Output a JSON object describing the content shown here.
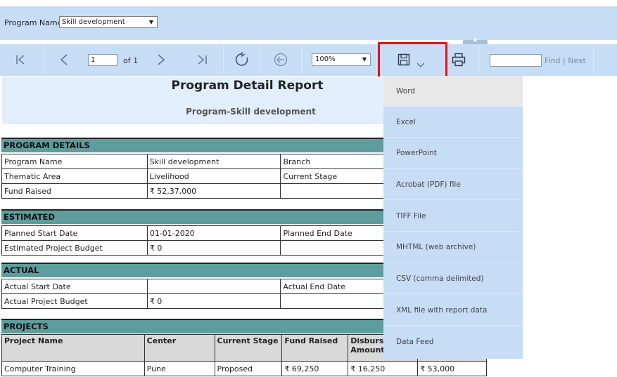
{
  "params": {
    "program_label": "Program Name",
    "program_value": "Skill development"
  },
  "toolbar": {
    "page_value": "1",
    "of_label": "of 1",
    "zoom_value": "100%",
    "find_links": "Find | Next"
  },
  "report": {
    "title": "Program Detail Report",
    "subtitle": "Program-Skill development",
    "program_details": {
      "heading": "PROGRAM DETAILS",
      "rows": [
        [
          "Program Name",
          "Skill development",
          "Branch",
          ""
        ],
        [
          "Thematic Area",
          "Livelihood",
          "Current Stage",
          ""
        ],
        [
          "Fund Raised",
          "₹ 52,37,000",
          "",
          ""
        ]
      ]
    },
    "estimated": {
      "heading": "ESTIMATED",
      "rows": [
        [
          "Planned Start Date",
          "01-01-2020",
          "Planned End Date",
          ""
        ],
        [
          "Estimated Project Budget",
          "₹ 0",
          "",
          ""
        ]
      ]
    },
    "actual": {
      "heading": "ACTUAL",
      "rows": [
        [
          "Actual Start Date",
          "",
          "Actual End Date",
          ""
        ],
        [
          "Actual Project Budget",
          "₹ 0",
          "",
          ""
        ]
      ]
    },
    "projects": {
      "heading": "PROJECTS",
      "columns": [
        "Project Name",
        "Center",
        "Current Stage",
        "Fund Raised",
        "Disburse",
        "Amount"
      ],
      "row": [
        "Computer Training",
        "Pune",
        "Proposed",
        "₹ 69,250",
        "₹ 16,250",
        "₹ 53,000"
      ]
    }
  },
  "export_menu": {
    "items": [
      "Word",
      "Excel",
      "PowerPoint",
      "Acrobat (PDF) file",
      "TIFF File",
      "MHTML (web archive)",
      "CSV (comma delimited)",
      "XML file with report data",
      "Data Feed"
    ]
  },
  "colors": {
    "toolbar_bg": "#c7dcf5",
    "section_header": "#5e9d9d",
    "highlight": "#e0121b"
  }
}
